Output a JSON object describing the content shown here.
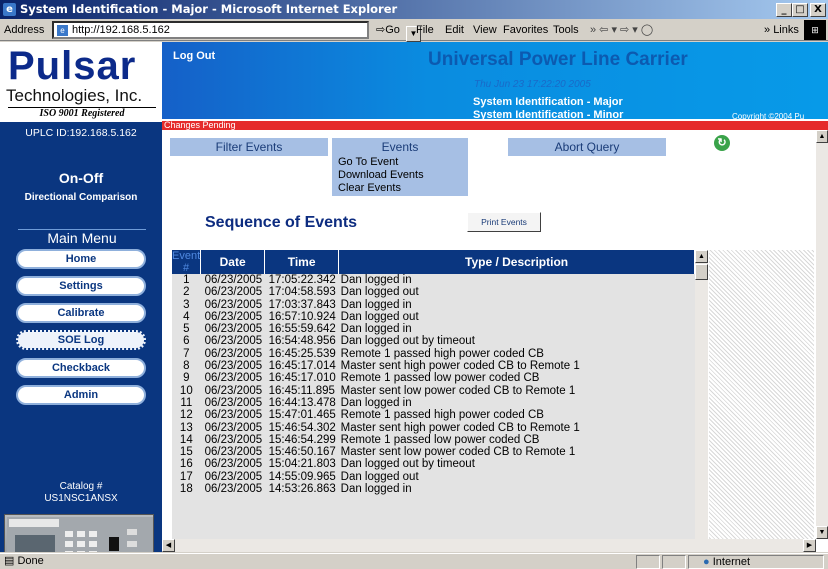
{
  "window": {
    "title": "System Identification - Major - Microsoft Internet Explorer",
    "min": "_",
    "max": "□",
    "close": "X"
  },
  "addressbar": {
    "label": "Address",
    "url": "http://192.168.5.162",
    "go": "Go",
    "menus": [
      "File",
      "Edit",
      "View",
      "Favorites",
      "Tools"
    ],
    "links": "Links"
  },
  "logo": {
    "name": "Pulsar",
    "company": "Technologies, Inc.",
    "iso": "ISO 9001 Registered"
  },
  "banner": {
    "logout": "Log Out",
    "title": "Universal Power Line Carrier",
    "datetime": "Thu Jun 23 17:22:20 2005",
    "system_major": "System Identification - Major",
    "system_minor": "System Identification - Minor",
    "copyright": "Copyright ©2004 Pu"
  },
  "status_strip": "Changes Pending",
  "sidebar": {
    "uplc_id": "UPLC ID:192.168.5.162",
    "mode": "On-Off",
    "scheme": "Directional Comparison",
    "menu_title": "Main Menu",
    "menu": [
      "Home",
      "Settings",
      "Calibrate",
      "SOE Log",
      "Checkback",
      "Admin"
    ],
    "catalog_label": "Catalog #",
    "catalog_value": "US1NSC1ANSX"
  },
  "tabs": {
    "filter": "Filter Events",
    "events": "Events",
    "abort": "Abort Query"
  },
  "events_menu": [
    "Go To Event",
    "Download Events",
    "Clear Events"
  ],
  "soe": {
    "title": "Sequence of Events",
    "print": "Print Events"
  },
  "table": {
    "headers": [
      "Event #",
      "Date",
      "Time",
      "Type / Description"
    ],
    "rows": [
      [
        "1",
        "06/23/2005",
        "17:05:22.342",
        "Dan logged in"
      ],
      [
        "2",
        "06/23/2005",
        "17:04:58.593",
        "Dan logged out"
      ],
      [
        "3",
        "06/23/2005",
        "17:03:37.843",
        "Dan logged in"
      ],
      [
        "4",
        "06/23/2005",
        "16:57:10.924",
        "Dan logged out"
      ],
      [
        "5",
        "06/23/2005",
        "16:55:59.642",
        "Dan logged in"
      ],
      [
        "6",
        "06/23/2005",
        "16:54:48.956",
        "Dan logged out by timeout"
      ],
      [
        "7",
        "06/23/2005",
        "16:45:25.539",
        "Remote 1 passed high power coded CB"
      ],
      [
        "8",
        "06/23/2005",
        "16:45:17.014",
        "Master sent high power coded CB to Remote 1"
      ],
      [
        "9",
        "06/23/2005",
        "16:45:17.010",
        "Remote 1 passed low power coded CB"
      ],
      [
        "10",
        "06/23/2005",
        "16:45:11.895",
        "Master sent low power coded CB to Remote 1"
      ],
      [
        "11",
        "06/23/2005",
        "16:44:13.478",
        "Dan logged in"
      ],
      [
        "12",
        "06/23/2005",
        "15:47:01.465",
        "Remote 1 passed high power coded CB"
      ],
      [
        "13",
        "06/23/2005",
        "15:46:54.302",
        "Master sent high power coded CB to Remote 1"
      ],
      [
        "14",
        "06/23/2005",
        "15:46:54.299",
        "Remote 1 passed low power coded CB"
      ],
      [
        "15",
        "06/23/2005",
        "15:46:50.167",
        "Master sent low power coded CB to Remote 1"
      ],
      [
        "16",
        "06/23/2005",
        "15:04:21.803",
        "Dan logged out by timeout"
      ],
      [
        "17",
        "06/23/2005",
        "14:55:09.965",
        "Dan logged out"
      ],
      [
        "18",
        "06/23/2005",
        "14:53:26.863",
        "Dan logged in"
      ]
    ]
  },
  "statusbar": {
    "left": "Done",
    "zone": "Internet"
  },
  "colors": {
    "navy": "#0a3680",
    "banner": "#0a8ce0",
    "alert": "#e52b2b",
    "tab": "#a6bfe4"
  }
}
